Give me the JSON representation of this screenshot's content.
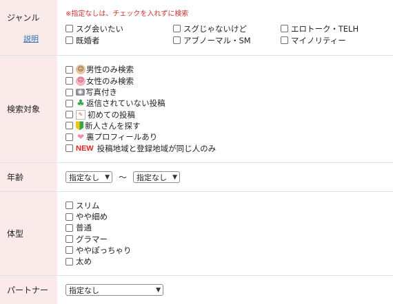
{
  "genre": {
    "label": "ジャンル",
    "explain_link": "説明",
    "note": "※指定なしは、チェックを入れずに検索",
    "options": [
      "スグ会いたい",
      "スグじゃないけど",
      "エロトーク・TELH",
      "既婚者",
      "アブノーマル・SM",
      "マイノリティー"
    ]
  },
  "search_target": {
    "label": "検索対象",
    "options": [
      {
        "icon": "man-face-icon",
        "label": "男性のみ検索"
      },
      {
        "icon": "woman-face-icon",
        "label": "女性のみ検索"
      },
      {
        "icon": "camera-icon",
        "label": "写真付き"
      },
      {
        "icon": "clover-icon",
        "label": "返信されていない投稿"
      },
      {
        "icon": "first-post-icon",
        "label": "初めての投稿"
      },
      {
        "icon": "beginner-mark-icon",
        "label": "新人さんを探す"
      },
      {
        "icon": "heart-icon",
        "label": "裏プロフィールあり"
      },
      {
        "icon": "new-badge",
        "badge": "NEW",
        "label": "投稿地域と登録地域が同じ人のみ"
      }
    ]
  },
  "age": {
    "label": "年齢",
    "from_value": "指定なし",
    "separator": "〜",
    "to_value": "指定なし"
  },
  "body_type": {
    "label": "体型",
    "options": [
      "スリム",
      "やや細め",
      "普通",
      "グラマー",
      "ややぽっちゃり",
      "太め"
    ]
  },
  "partner": {
    "label": "パートナー",
    "value": "指定なし"
  },
  "colors": {
    "label_bg": "#fbeaea",
    "note_red": "#d0312d",
    "link_blue": "#2a6fb5",
    "border": "#d9e2ea"
  }
}
